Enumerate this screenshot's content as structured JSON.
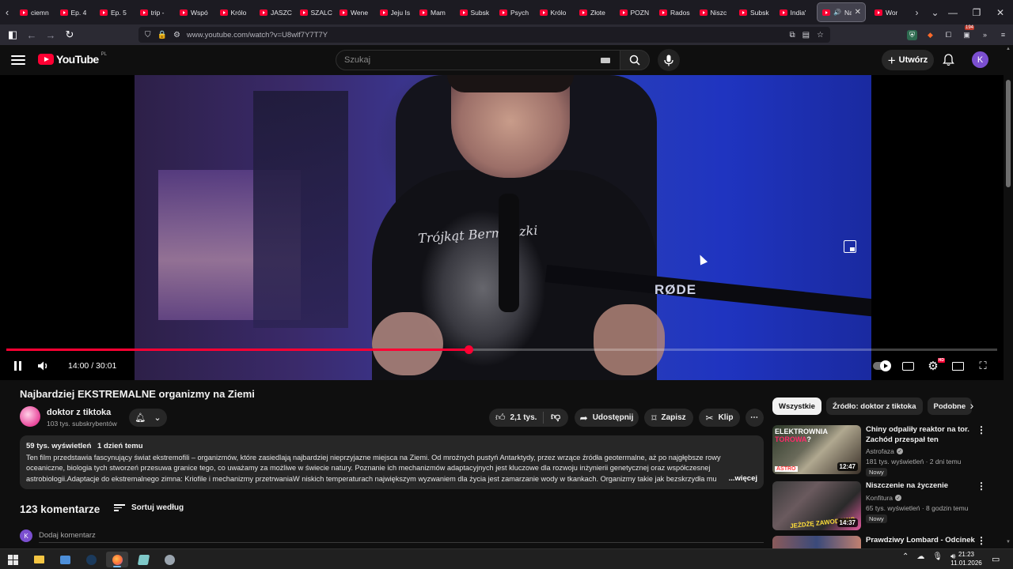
{
  "browser": {
    "tabs": [
      "ciemn",
      "Ep. 4",
      "Ep. 5",
      "trip -",
      "Wspó",
      "Królo",
      "JASZC",
      "SZALC",
      "Wene",
      "Jeju Is",
      "Mam",
      "Subsk",
      "Psych",
      "Królo",
      "Złote",
      "POZN",
      "Rados",
      "Niszc",
      "Subsk",
      "India'"
    ],
    "active_tab": "Naj",
    "after_tab": "Wor",
    "url": "www.youtube.com/watch?v=U8wlf7Y7T7Y",
    "extension_badge": "194",
    "icons": {
      "back": "back-arrow-icon",
      "forward": "forward-arrow-icon",
      "reload": "reload-icon",
      "shield": "shield-icon",
      "lock": "lock-icon"
    }
  },
  "yt_header": {
    "logo_text": "YouTube",
    "region": "PL",
    "search_placeholder": "Szukaj",
    "create_label": "Utwórz",
    "avatar_letter": "K",
    "brand_color": "#ff0033"
  },
  "player": {
    "time": "14:00 / 30:01",
    "progress_fraction": 0.4664,
    "overlay_texts": {
      "mic_brand": "RØDE",
      "shirt_text": "Trójkąt Bermudzki"
    },
    "hd_badge": "HD"
  },
  "video": {
    "title": "Najbardziej EKSTREMALNE organizmy na Ziemi",
    "channel": {
      "name": "doktor z tiktoka",
      "subscribers": "103 tys. subskrybentów"
    },
    "actions": {
      "likes": "2,1 tys.",
      "share": "Udostępnij",
      "save": "Zapisz",
      "clip": "Klip"
    },
    "description": {
      "views": "59 tys. wyświetleń",
      "age": "1 dzień temu",
      "text": "Ten film przedstawia fascynujący świat ekstremofili – organizmów, które zasiedlają najbardziej nieprzyjazne miejsca na Ziemi. Od mroźnych pustyń Antarktydy, przez wrzące źródła geotermalne, aż po najgłębsze rowy oceaniczne, biologia tych stworzeń przesuwa granice tego, co uważamy za możliwe w świecie natury. Poznanie ich mechanizmów adaptacyjnych jest kluczowe dla rozwoju inżynierii genetycznej oraz współczesnej astrobiologii.Adaptacje do ekstremalnego zimna: Kriofile i mechanizmy przetrwaniaW niskich temperaturach największym wyzwaniem dla życia jest zamarzanie wody w tkankach. Organizmy takie jak bezskrzydła mu",
      "more": "...więcej"
    }
  },
  "comments": {
    "count": "123 komentarze",
    "sort_label": "Sortuj według",
    "add_placeholder": "Dodaj komentarz",
    "avatar_letter": "K"
  },
  "sidebar": {
    "chips": [
      "Wszystkie",
      "Źródło: doktor z tiktoka",
      "Podobne"
    ],
    "recommendations": [
      {
        "title": "Chiny odpaliły reaktor na tor. Zachód przespał ten moment?...",
        "channel": "Astrofaza",
        "verified": true,
        "meta": "181 tys. wyświetleń · 2 dni temu",
        "badge": "Nowy",
        "duration": "12:47",
        "thumb_text_a": "ELEKTROWNIA ",
        "thumb_text_b": "TOROWA",
        "thumb_text_c": "?",
        "thumb_brand": "ASTRO"
      },
      {
        "title": "Niszczenie na życzenie",
        "channel": "Konfitura",
        "verified": true,
        "meta": "65 tys. wyświetleń · 8 godzin temu",
        "badge": "Nowy",
        "duration": "14:37",
        "thumb_text": "JEŻDŻĘ ZAWODOWO"
      },
      {
        "title": "Prawdziwy Lombard - Odcinek",
        "channel": "",
        "meta": "",
        "badge": "",
        "duration": ""
      }
    ]
  },
  "taskbar": {
    "time": "21:23",
    "date": "11.01.2026"
  }
}
